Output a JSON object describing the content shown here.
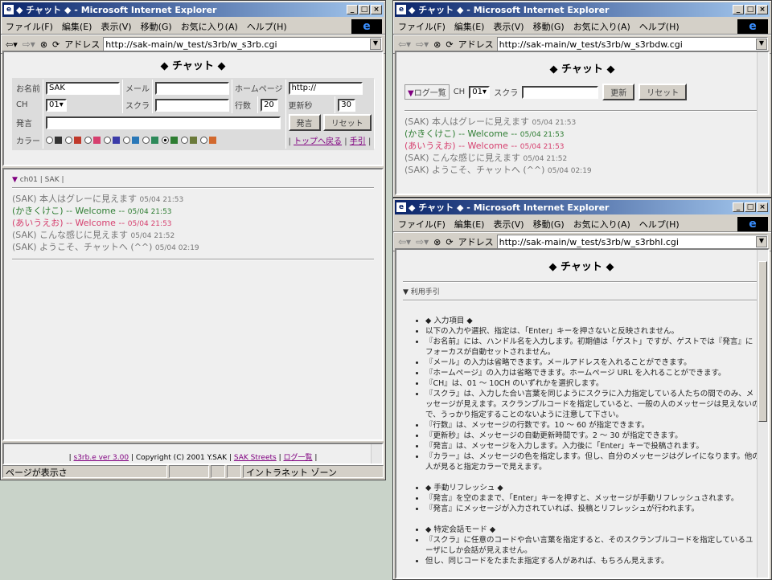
{
  "win_title": "◆ チャット ◆ - Microsoft Internet Explorer",
  "menu": [
    "ファイル(F)",
    "編集(E)",
    "表示(V)",
    "移動(G)",
    "お気に入り(A)",
    "ヘルプ(H)"
  ],
  "address_label": "アドレス",
  "left": {
    "url": "http://sak-main/w_test/s3rb/w_s3rb.cgi",
    "heading": "◆ チャット ◆",
    "name_label": "お名前",
    "name_value": "SAK",
    "mail_label": "メール",
    "home_label": "ホームページ",
    "home_value": "http://",
    "ch_label": "CH",
    "ch_value": "01",
    "scra_label": "スクラ",
    "lines_label": "行数",
    "lines_value": "20",
    "refresh_label": "更新秒",
    "refresh_value": "30",
    "say_label": "発言",
    "say_button": "発言",
    "reset_button": "リセット",
    "color_label": "カラー",
    "colors": [
      "#333333",
      "#c0392b",
      "#d63f6e",
      "#3a3aa8",
      "#2a78b8",
      "#2e8a5a",
      "#2e7d32",
      "#6b7a3a",
      "#d2692e"
    ],
    "link_top": "トップへ戻る",
    "link_help": "手引",
    "ch_header": "ch01",
    "ch_user": "SAK",
    "footer_version": "s3rb.e ver 3.00",
    "footer_copy": "Copyright (C) 2001 Y.SAK",
    "footer_streets": "SAK Streets",
    "footer_log": "ログ一覧",
    "status_text": "ページが表示さ",
    "status_zone": "イントラネット ゾーン"
  },
  "messages": [
    {
      "name": "(SAK)",
      "text": "本人はグレーに見えます",
      "time": "05/04 21:53",
      "color": "#777777"
    },
    {
      "name": "(かきくけこ)",
      "text": "-- Welcome --",
      "time": "05/04 21:53",
      "color": "#2e7d32"
    },
    {
      "name": "(あいうえお)",
      "text": "-- Welcome --",
      "time": "05/04 21:53",
      "color": "#d63f6e"
    },
    {
      "name": "(SAK)",
      "text": "こんな感じに見えます",
      "time": "05/04 21:52",
      "color": "#777777"
    },
    {
      "name": "(SAK)",
      "text": "ようこそ、チャットへ (^^)",
      "time": "05/04 02:19",
      "color": "#777777"
    }
  ],
  "rt": {
    "url": "http://sak-main/w_test/s3rb/w_s3rbdw.cgi",
    "heading": "◆ チャット ◆",
    "log_label": "ログ一覧",
    "ch_label": "CH",
    "ch_value": "01",
    "scra_label": "スクラ",
    "update_button": "更新",
    "reset_button": "リセット"
  },
  "rb": {
    "url": "http://sak-main/w_test/s3rb/w_s3rbhl.cgi",
    "heading": "◆ チャット ◆",
    "guide_label": "利用手引",
    "items": [
      "◆ 入力項目 ◆",
      "以下の入力や選択、指定は、「Enter」キーを押さないと反映されません。",
      "『お名前』には、ハンドル名を入力します。初期値は「ゲスト」ですが、ゲストでは『発言』にフォーカスが自動セットされません。",
      "『メール』の入力は省略できます。メールアドレスを入れることができます。",
      "『ホームページ』の入力は省略できます。ホームページ URL を入れることができます。",
      "『CH』は、01 ～ 10CH のいずれかを選択します。",
      "『スクラ』は、入力した合い言葉を同じようにスクラに入力指定している人たちの間でのみ、メッセージが見えます。スクランブルコードを指定していると、一般の人のメッセージは見えないので、うっかり指定することのないように注意して下さい。",
      "『行数』は、メッセージの行数です。10 ～ 60 が指定できます。",
      "『更新秒』は、メッセージの自動更新時間です。2 ～ 30 が指定できます。",
      "『発言』は、メッセージを入力します。入力後に「Enter」キーで投稿されます。",
      "『カラー』は、メッセージの色を指定します。但し、自分のメッセージはグレイになります。他の人が見ると指定カラーで見えます。",
      "◆ 手動リフレッシュ ◆",
      "『発言』を空のままで、「Enter」キーを押すと、メッセージが手動リフレッシュされます。",
      "『発言』にメッセージが入力されていれば、投稿とリフレッシュが行われます。",
      "◆ 特定会話モード ◆",
      "『スクラ』に任意のコードや合い言葉を指定すると、そのスクランブルコードを指定しているユーザにしか会話が見えません。",
      "但し、同じコードをたまたま指定する人があれば、もちろん見えます。"
    ]
  }
}
